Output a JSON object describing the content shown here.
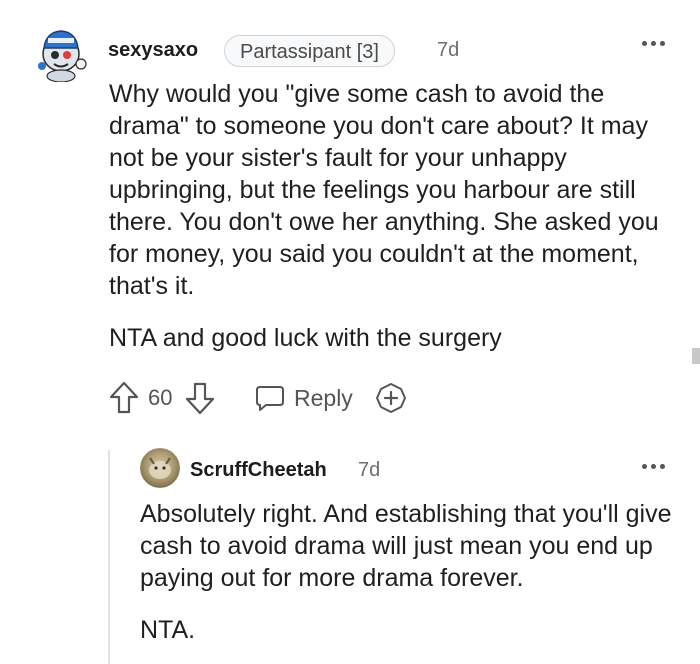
{
  "comment": {
    "username": "sexysaxo",
    "flair": "Partassipant [3]",
    "time": "7d",
    "paragraphs": [
      "Why would you \"give some cash to avoid the drama\" to someone you don't care about? It may not be your sister's fault for your unhappy upbringing, but the feelings you harbour are still there. You don't owe her anything. She asked you for money, you said you couldn't at the moment, that's it.",
      "NTA and good luck with the surgery"
    ],
    "votes": "60",
    "reply_label": "Reply"
  },
  "reply": {
    "username": "ScruffCheetah",
    "time": "7d",
    "paragraphs": [
      "Absolutely right. And establishing that you'll give cash to avoid drama will just mean you end up paying out for more drama forever.",
      "NTA."
    ]
  },
  "icons": {
    "upvote": "arrow-up-icon",
    "downvote": "arrow-down-icon",
    "reply": "speech-bubble-icon",
    "award": "award-plus-icon",
    "more": "ellipsis-icon"
  },
  "colors": {
    "text": "#1f1f1f",
    "meta": "#6b6e70",
    "flair_border": "#cfd3d6",
    "thread_line": "#e1e3e5"
  }
}
